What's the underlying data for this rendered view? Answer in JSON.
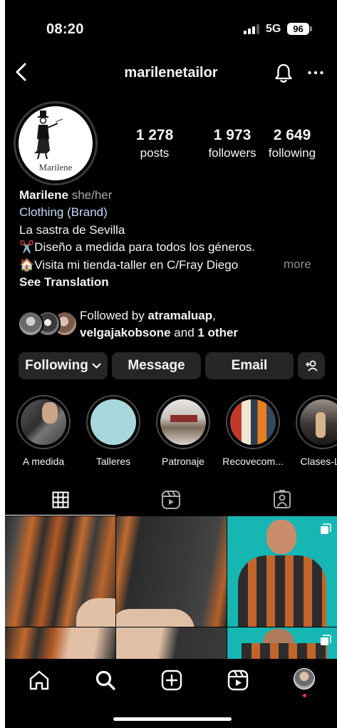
{
  "status_bar": {
    "time": "08:20",
    "network": "5G",
    "battery": "96"
  },
  "header": {
    "username": "marilenetailor"
  },
  "profile": {
    "avatar_brand": "Marilene",
    "stats": [
      {
        "value": "1 278",
        "label": "posts"
      },
      {
        "value": "1 973",
        "label": "followers"
      },
      {
        "value": "2 649",
        "label": "following"
      }
    ]
  },
  "bio": {
    "name": "Marilene",
    "pronouns": "she/her",
    "category": "Clothing (Brand)",
    "line1": "La sastra de Sevilla",
    "line2_emoji": "✂️",
    "line2": "Diseño a medida para todos los géneros.",
    "line3_emoji": "🏠",
    "line3": "Visita mi tienda-taller en C/Fray Diego",
    "more": "more",
    "see_translation": "See Translation"
  },
  "followed_by": {
    "prefix": "Followed by ",
    "user1": "atramaluap",
    "sep": ",",
    "user2": "velgajakobsone",
    "and": " and ",
    "others": "1 other"
  },
  "actions": {
    "following": "Following",
    "message": "Message",
    "email": "Email"
  },
  "highlights": [
    {
      "label": "A medida"
    },
    {
      "label": "Talleres"
    },
    {
      "label": "Patronaje"
    },
    {
      "label": "Recovecom..."
    },
    {
      "label": "Clases-Le"
    }
  ],
  "tabs": [
    "grid-icon",
    "reels-icon",
    "tagged-icon"
  ],
  "tab_bar": [
    "home-icon",
    "search-icon",
    "create-icon",
    "reels-icon",
    "profile-avatar"
  ],
  "colors": {
    "background": "#000000",
    "button": "#262626",
    "link": "#c6dcff",
    "muted": "#a8a8a8",
    "notification_dot": "#ff3040"
  }
}
